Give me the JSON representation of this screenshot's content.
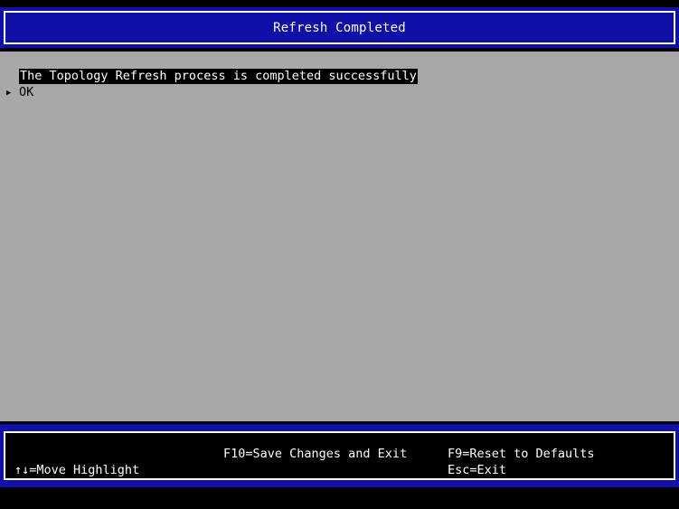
{
  "header": {
    "title": "Refresh Completed"
  },
  "main": {
    "message": "The Topology Refresh process is completed successfully",
    "option": {
      "marker": "▶",
      "label": "OK"
    }
  },
  "footer": {
    "move_highlight": "↑↓=Move Highlight",
    "save_exit": "F10=Save Changes and Exit",
    "reset_defaults": "F9=Reset to Defaults",
    "esc_exit": "Esc=Exit"
  },
  "colors": {
    "header_blue": "#1010a8",
    "panel_gray": "#a8a8a8",
    "background": "#000000",
    "text": "#ffffff"
  }
}
